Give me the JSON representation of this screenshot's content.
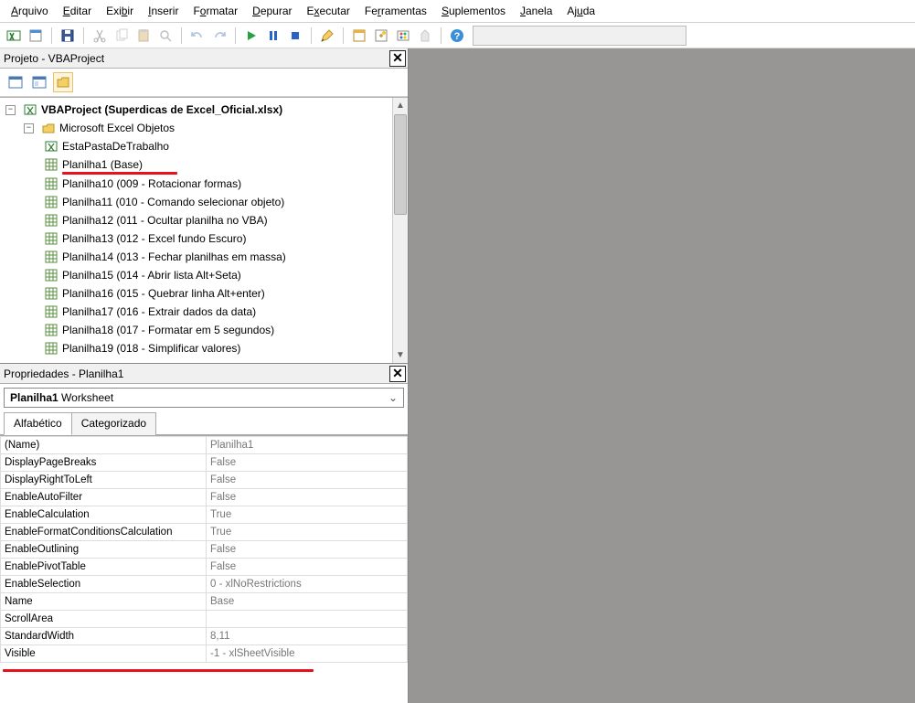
{
  "menu": {
    "items": [
      {
        "u": "A",
        "rest": "rquivo"
      },
      {
        "u": "E",
        "rest": "ditar"
      },
      {
        "u": "E",
        "pre": "Exi",
        "urest": "b",
        "post": "ir",
        "full": "Exibir"
      },
      {
        "u": "I",
        "rest": "nserir"
      },
      {
        "u": "F",
        "pre": "F",
        "urest": "o",
        "post": "rmatar",
        "full": "Formatar"
      },
      {
        "u": "D",
        "rest": "epurar"
      },
      {
        "u": "E",
        "pre": "E",
        "urest": "x",
        "post": "ecutar",
        "full": "Executar"
      },
      {
        "u": "F",
        "pre": "Fe",
        "urest": "r",
        "post": "ramentas",
        "full": "Ferramentas"
      },
      {
        "u": "S",
        "rest": "uplementos"
      },
      {
        "u": "J",
        "rest": "anela"
      },
      {
        "u": "A",
        "pre": "Aj",
        "urest": "u",
        "post": "da",
        "full": "Ajuda"
      }
    ]
  },
  "projectPane": {
    "title": "Projeto - VBAProject",
    "root": "VBAProject (Superdicas de Excel_Oficial.xlsx)",
    "folder": "Microsoft Excel Objetos",
    "items": [
      "EstaPastaDeTrabalho",
      "Planilha1 (Base)",
      "Planilha10 (009 - Rotacionar formas)",
      "Planilha11 (010 - Comando selecionar objeto)",
      "Planilha12 (011 - Ocultar planilha no VBA)",
      "Planilha13 (012 - Excel fundo Escuro)",
      "Planilha14 (013 - Fechar planilhas em massa)",
      "Planilha15 (014 - Abrir lista Alt+Seta)",
      "Planilha16 (015 - Quebrar linha Alt+enter)",
      "Planilha17 (016 - Extrair dados da data)",
      "Planilha18 (017 - Formatar em 5 segundos)",
      "Planilha19 (018 - Simplificar valores)"
    ]
  },
  "propsPane": {
    "title": "Propriedades - Planilha1",
    "objName": "Planilha1",
    "objType": "Worksheet",
    "tabs": {
      "alpha": "Alfabético",
      "cat": "Categorizado"
    },
    "rows": [
      {
        "k": "(Name)",
        "v": "Planilha1"
      },
      {
        "k": "DisplayPageBreaks",
        "v": "False"
      },
      {
        "k": "DisplayRightToLeft",
        "v": "False"
      },
      {
        "k": "EnableAutoFilter",
        "v": "False"
      },
      {
        "k": "EnableCalculation",
        "v": "True"
      },
      {
        "k": "EnableFormatConditionsCalculation",
        "v": "True"
      },
      {
        "k": "EnableOutlining",
        "v": "False"
      },
      {
        "k": "EnablePivotTable",
        "v": "False"
      },
      {
        "k": "EnableSelection",
        "v": "0 - xlNoRestrictions"
      },
      {
        "k": "Name",
        "v": "Base"
      },
      {
        "k": "ScrollArea",
        "v": ""
      },
      {
        "k": "StandardWidth",
        "v": "8,11"
      },
      {
        "k": "Visible",
        "v": "-1 - xlSheetVisible"
      }
    ]
  }
}
